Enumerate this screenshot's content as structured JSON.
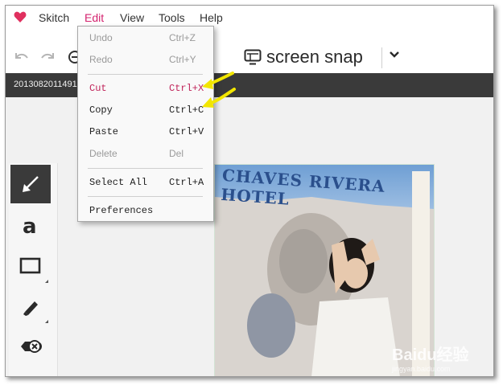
{
  "app": {
    "name": "Skitch"
  },
  "menubar": {
    "items": [
      "Skitch",
      "Edit",
      "View",
      "Tools",
      "Help"
    ],
    "active": "Edit"
  },
  "toolbar": {
    "snap_label": "screen snap"
  },
  "file": {
    "name": "201308201149154"
  },
  "edit_menu": {
    "undo": {
      "label": "Undo",
      "shortcut": "Ctrl+Z",
      "enabled": false
    },
    "redo": {
      "label": "Redo",
      "shortcut": "Ctrl+Y",
      "enabled": false
    },
    "cut": {
      "label": "Cut",
      "shortcut": "Ctrl+X",
      "enabled": true
    },
    "copy": {
      "label": "Copy",
      "shortcut": "Ctrl+C",
      "enabled": true
    },
    "paste": {
      "label": "Paste",
      "shortcut": "Ctrl+V",
      "enabled": true
    },
    "delete": {
      "label": "Delete",
      "shortcut": "Del",
      "enabled": false
    },
    "select_all": {
      "label": "Select All",
      "shortcut": "Ctrl+A",
      "enabled": true
    },
    "preferences": {
      "label": "Preferences"
    }
  },
  "photo": {
    "sign_text": "CHAVES RIVERA HOTEL"
  },
  "watermark": {
    "text": "Baidu经验",
    "sub": "jingyan.baidu.com"
  },
  "colors": {
    "accent": "#d4236f",
    "cut_text": "#c0245a",
    "disabled_text": "#9a9a9a",
    "annotation_arrow": "#f2e600",
    "darkbar": "#3a3a3a"
  }
}
